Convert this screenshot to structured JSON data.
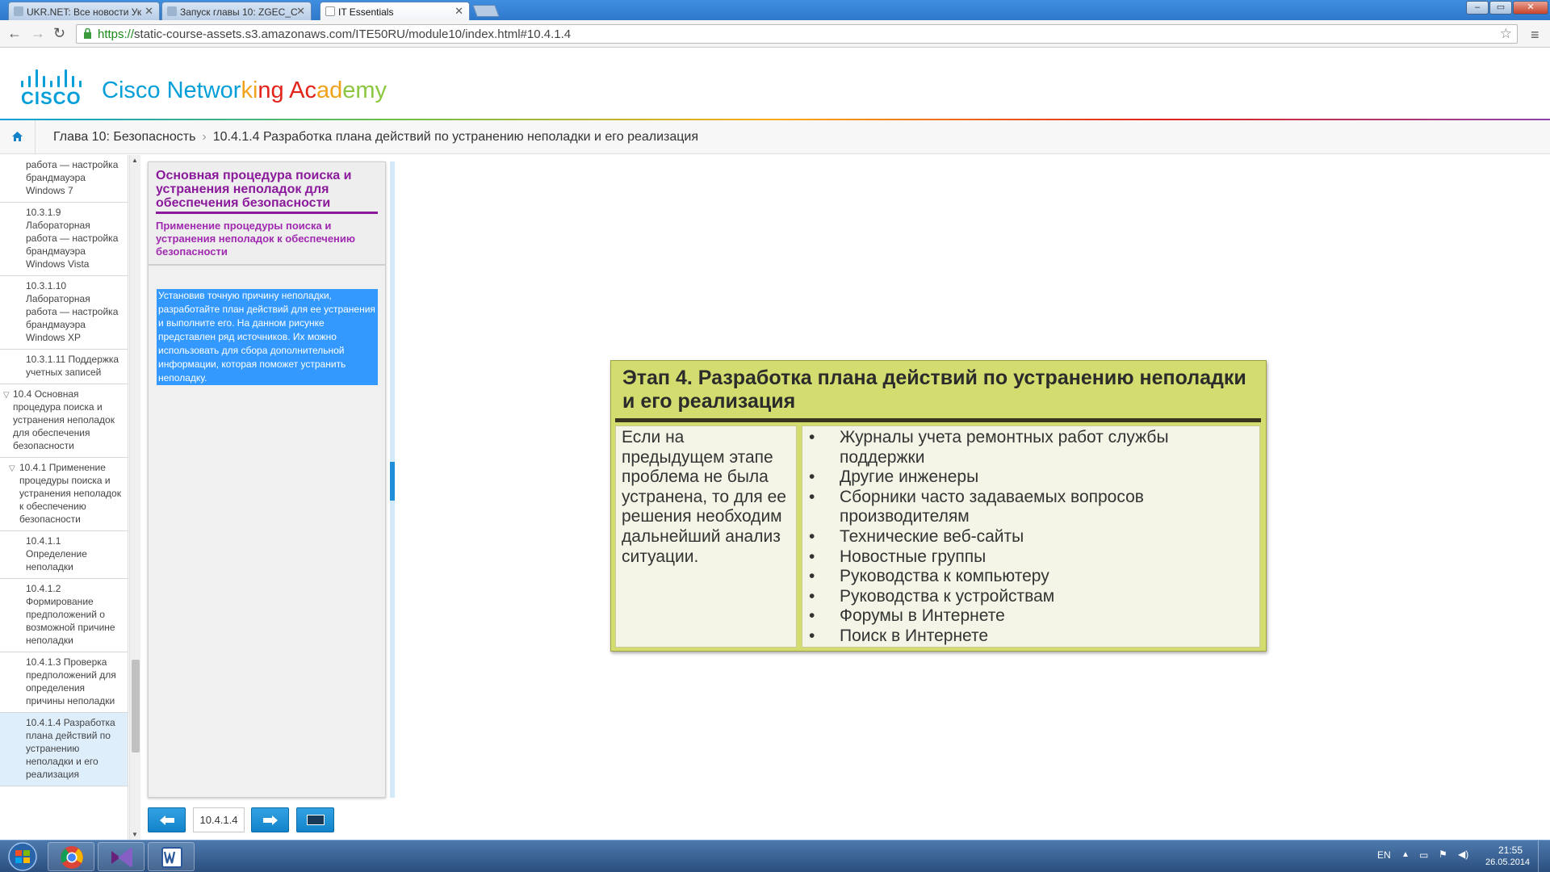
{
  "browser": {
    "tabs": [
      {
        "title": "UKR.NET: Все новости Ук",
        "active": false
      },
      {
        "title": "Запуск главы 10: ZGEC_C",
        "active": false
      },
      {
        "title": "IT Essentials",
        "active": true
      }
    ],
    "url_scheme": "https://",
    "url_rest": "static-course-assets.s3.amazonaws.com/ITE50RU/module10/index.html#10.4.1.4",
    "window_buttons": [
      "–",
      "▭",
      "✕"
    ]
  },
  "header": {
    "logo_word": "CISCO",
    "academy_parts": [
      {
        "text": "Cisco Networ",
        "color": "#049fd9"
      },
      {
        "text": "ki",
        "color": "#f0a31b"
      },
      {
        "text": "ng ",
        "color": "#e2231a"
      },
      {
        "text": "Ac",
        "color": "#e2231a"
      },
      {
        "text": "ad",
        "color": "#f0a31b"
      },
      {
        "text": "emy",
        "color": "#8cc63f"
      }
    ]
  },
  "breadcrumb": {
    "chapter": "Глава 10: Безопасность",
    "separator": "›",
    "page": "10.4.1.4 Разработка плана действий по устранению неполадки и его реализация"
  },
  "toc": [
    {
      "level": 3,
      "text": "работа — настройка брандмауэра Windows 7"
    },
    {
      "level": 3,
      "text": "10.3.1.9 Лабораторная работа — настройка брандмауэра Windows Vista"
    },
    {
      "level": 3,
      "text": "10.3.1.10 Лабораторная работа — настройка брандмауэра Windows XP"
    },
    {
      "level": 3,
      "text": "10.3.1.11 Поддержка учетных записей"
    },
    {
      "level": 1,
      "text": "10.4 Основная процедура поиска и устранения неполадок для обеспечения безопасности",
      "expanded": true
    },
    {
      "level": 2,
      "text": "10.4.1 Применение процедуры поиска и устранения неполадок к обеспечению безопасности",
      "expanded": true
    },
    {
      "level": 3,
      "text": "10.4.1.1 Определение неполадки"
    },
    {
      "level": 3,
      "text": "10.4.1.2 Формирование предположений о возможной причине неполадки"
    },
    {
      "level": 3,
      "text": "10.4.1.3 Проверка предположений для определения причины неполадки"
    },
    {
      "level": 3,
      "text": "10.4.1.4 Разработка плана действий по устранению неполадки и его реализация",
      "selected": true
    }
  ],
  "text_panel": {
    "module_title": "Основная процедура поиска и устранения неполадок для обеспечения безопасности",
    "section_title": "Применение процедуры поиска и устранения неполадок к обеспечению безопасности",
    "body": "Установив точную причину неполадки, разработайте план действий для ее устранения и выполните его. На данном рисунке представлен ряд источников. Их можно использовать для сбора дополнительной информации, которая поможет устранить неполадку."
  },
  "bottom_nav": {
    "prev_icon": "left-arrow-icon",
    "page_number": "10.4.1.4",
    "next_icon": "right-arrow-icon",
    "media_icon": "screen-icon"
  },
  "figure": {
    "title": "Этап 4. Разработка плана действий по устранению неполадки и его реализация",
    "left_text": "Если на предыдущем этапе проблема не была устранена, то для ее решения необходим дальнейший анализ ситуации.",
    "bullet": "•",
    "sources": [
      "Журналы учета ремонтных работ службы поддержки",
      "Другие инженеры",
      "Сборники часто задаваемых вопросов производителям",
      "Технические веб-сайты",
      "Новостные группы",
      "Руководства к компьютеру",
      "Руководства к устройствам",
      "Форумы в Интернете",
      "Поиск в Интернете"
    ],
    "colors": {
      "header_bg": "#d3dc6f",
      "cell_bg": "#f4f5e6",
      "rule": "#3a3320"
    }
  },
  "taskbar": {
    "apps": [
      "chrome-icon",
      "visual-studio-icon",
      "word-icon"
    ],
    "lang": "EN",
    "time": "21:55",
    "date": "26.05.2014"
  }
}
